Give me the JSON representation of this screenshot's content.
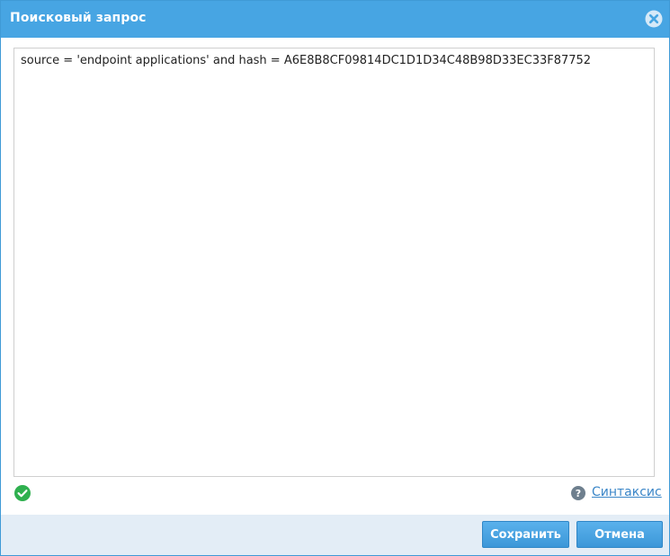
{
  "dialog": {
    "title": "Поисковый запрос",
    "close_icon": "close-circle-icon"
  },
  "query": {
    "value": "source = 'endpoint applications' and hash = A6E8B8CF09814DC1D1D34C48B98D33EC33F87752"
  },
  "status": {
    "icon": "check-circle-icon",
    "color": "#2fb04f"
  },
  "help": {
    "icon": "question-circle-icon",
    "syntax_label": "Синтаксис"
  },
  "footer": {
    "save_label": "Сохранить",
    "cancel_label": "Отмена"
  },
  "colors": {
    "titlebar": "#47a5e3",
    "button": "#3c97d8",
    "link": "#3a86c8",
    "footer": "#e3edf6"
  }
}
